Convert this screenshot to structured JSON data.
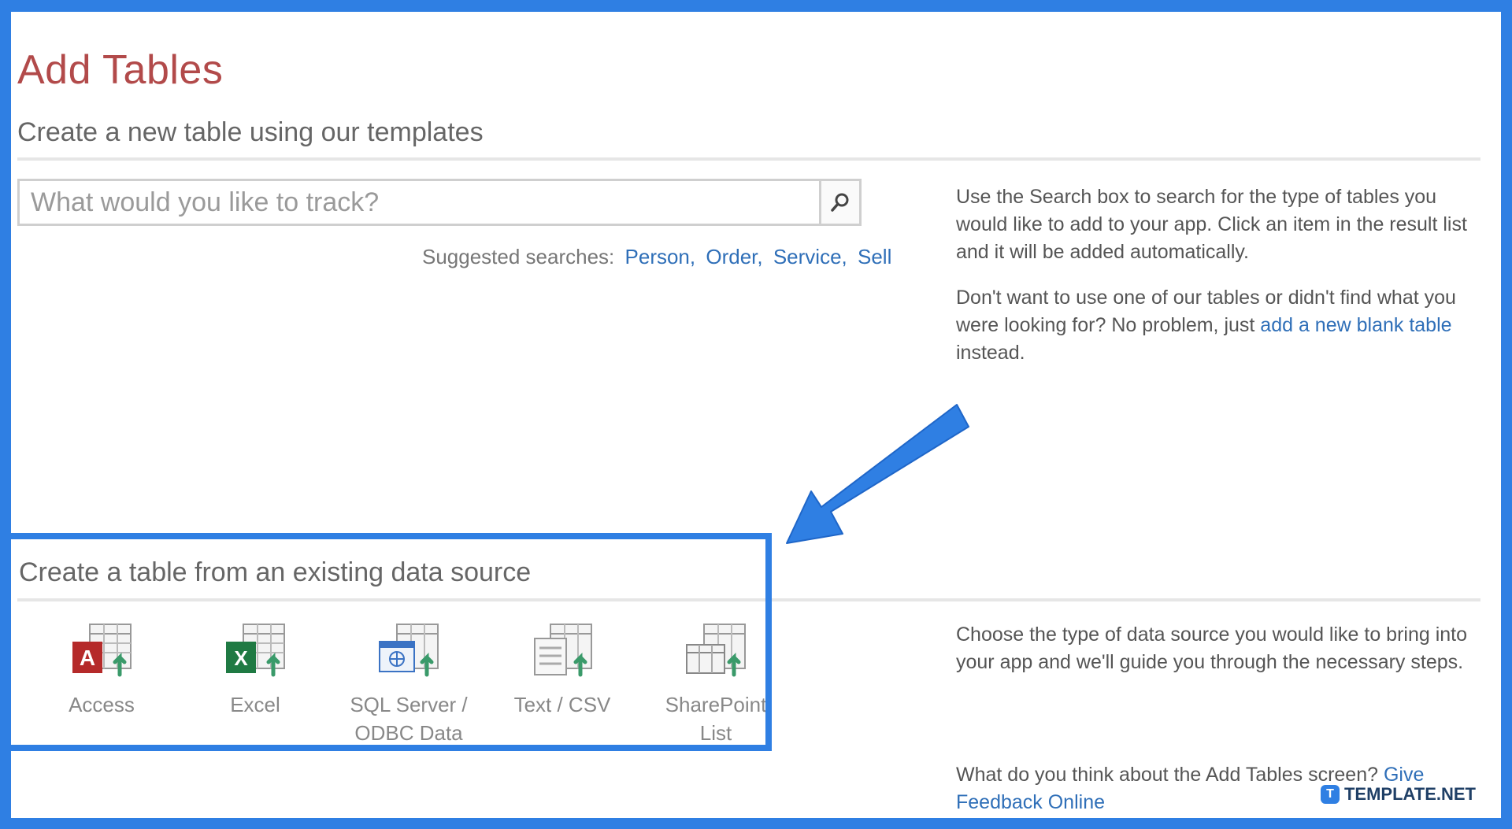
{
  "header": {
    "title": "Add Tables",
    "templates_section": "Create a new table using our templates",
    "datasource_section": "Create a table from an existing data source"
  },
  "search": {
    "placeholder": "What would you like to track?",
    "suggested_label": "Suggested searches:",
    "suggestions": [
      "Person,",
      "Order,",
      "Service,",
      "Sell"
    ]
  },
  "help": {
    "search_text": "Use the Search box to search for the type of tables you would like to add to your app. Click an item in the result list and it will be added automatically.",
    "blank_prefix": "Don't want to use one of our tables or didn't find what you were looking for? No problem, just ",
    "blank_link": "add a new blank table",
    "blank_suffix": " instead.",
    "datasource_text": "Choose the type of data source you would like to bring into your app and we'll guide you through the necessary steps.",
    "feedback_prefix": "What do you think about the Add Tables screen? ",
    "feedback_link": "Give Feedback Online"
  },
  "sources": [
    {
      "line1": "Access",
      "line2": "",
      "icon": "access-icon"
    },
    {
      "line1": "Excel",
      "line2": "",
      "icon": "excel-icon"
    },
    {
      "line1": "SQL Server /",
      "line2": "ODBC Data",
      "icon": "sql-server-icon"
    },
    {
      "line1": "Text / CSV",
      "line2": "",
      "icon": "text-csv-icon"
    },
    {
      "line1": "SharePoint",
      "line2": "List",
      "icon": "sharepoint-list-icon"
    }
  ],
  "brand": {
    "mark": "T",
    "name": "TEMPLATE.NET"
  },
  "colors": {
    "frame": "#2f7fe3",
    "title": "#b24a4a",
    "link": "#2f6fb8"
  }
}
